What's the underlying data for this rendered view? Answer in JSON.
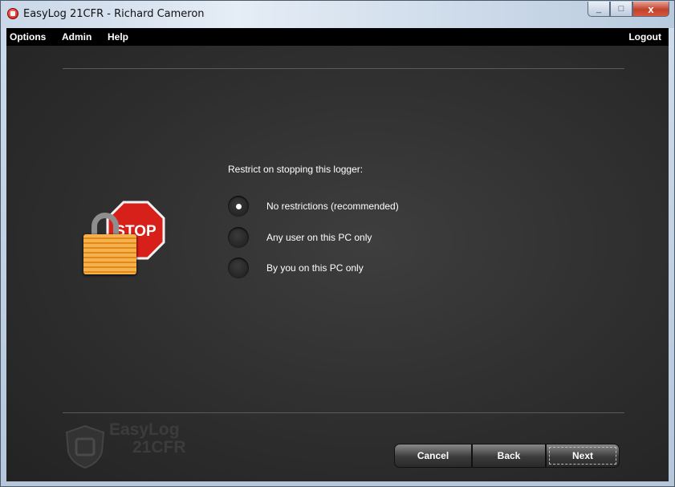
{
  "window": {
    "title": "EasyLog 21CFR - Richard Cameron",
    "controls": {
      "minimize": "_",
      "maximize": "□",
      "close": "x"
    }
  },
  "menu": {
    "items": [
      "Options",
      "Admin",
      "Help"
    ],
    "logout": "Logout"
  },
  "wizard": {
    "question": "Restrict on stopping this logger:",
    "options": [
      {
        "label": "No restrictions (recommended)",
        "selected": true
      },
      {
        "label": "Any user on this PC only",
        "selected": false
      },
      {
        "label": "By you on this PC only",
        "selected": false
      }
    ],
    "graphic": {
      "stop_text": "STOP",
      "icon": "stop-sign-padlock-icon"
    }
  },
  "watermark": {
    "line1": "EasyLog",
    "line2": "21CFR"
  },
  "buttons": {
    "cancel": "Cancel",
    "back": "Back",
    "next": "Next"
  },
  "colors": {
    "stop_red": "#d8201a",
    "lock_orange": "#f0a030",
    "close_red": "#c2412a"
  }
}
